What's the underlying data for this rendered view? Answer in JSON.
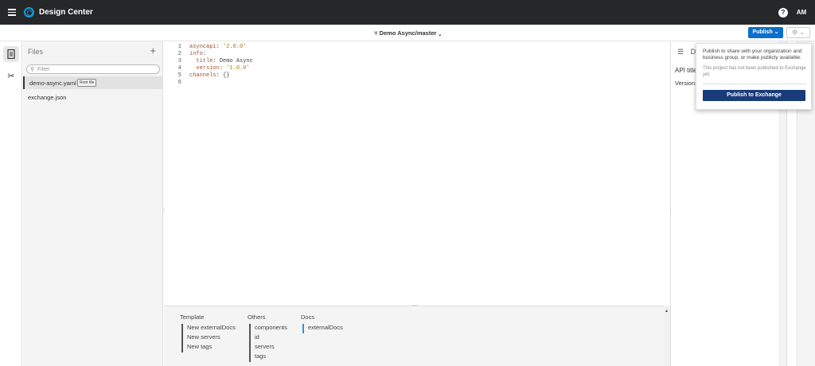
{
  "topbar": {
    "brand": "Design Center",
    "help": "?",
    "avatar_initials": "AM",
    "avatar_color": "#262728"
  },
  "subbar": {
    "branch_label": "Demo Async/master",
    "publish_label": "Publish"
  },
  "files": {
    "title": "Files",
    "add": "+",
    "filter_placeholder": "Filter",
    "items": [
      {
        "name": "demo-async.yaml",
        "badge": "Root file"
      },
      {
        "name": "exchange.json",
        "badge": ""
      }
    ]
  },
  "editor": {
    "lines": [
      {
        "n": "1",
        "key": "asyncapi",
        "sep": ": ",
        "val": "'2.0.0'"
      },
      {
        "n": "2",
        "key": "info",
        "sep": ":",
        "val": ""
      },
      {
        "n": "3",
        "key": "  title",
        "sep": ": ",
        "val": "Demo Async"
      },
      {
        "n": "4",
        "key": "  version",
        "sep": ": ",
        "val": "'1.0.0'"
      },
      {
        "n": "5",
        "key": "channels",
        "sep": ": ",
        "val": "{}"
      },
      {
        "n": "6",
        "key": "",
        "sep": "",
        "val": ""
      }
    ]
  },
  "suggestions": {
    "template": {
      "title": "Template",
      "items": [
        "New externalDocs",
        "New servers",
        "New tags"
      ]
    },
    "others": {
      "title": "Others",
      "items": [
        "components",
        "id",
        "servers",
        "tags"
      ]
    },
    "docs": {
      "title": "Docs",
      "items": [
        "externalDocs"
      ]
    }
  },
  "right_panel": {
    "head": "D",
    "api_title_label": "API title",
    "version_label": "Version:"
  },
  "popover": {
    "text": "Publish to share with your organization and business group, or make publicly available.",
    "note": "This project has not been published to Exchange yet.",
    "button": "Publish to Exchange"
  },
  "colors": {
    "topbar": "#262728",
    "publish": "#0b6fcb",
    "publish_exchange": "#183b7a",
    "logo": "#0d9ddb"
  }
}
